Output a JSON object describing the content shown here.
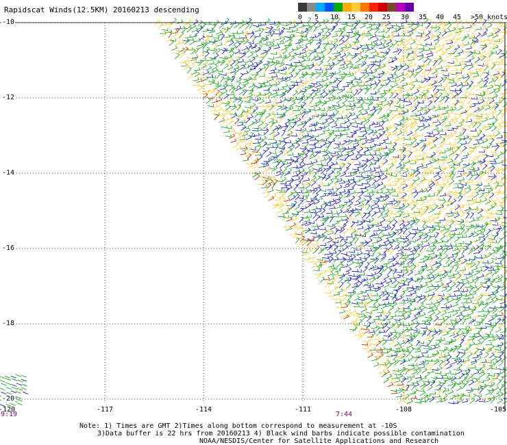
{
  "title": "Rapidscat Winds(12.5KM) 20160213 descending",
  "legend": {
    "labels": [
      "0",
      "5",
      "10",
      "15",
      "20",
      "25",
      "30",
      "35",
      "40",
      "45",
      ">50 knots"
    ],
    "colors": [
      "#3a3a3a",
      "#888888",
      "#00aaff",
      "#0055ff",
      "#00aa00",
      "#ffaa00",
      "#ffcc33",
      "#ff7700",
      "#ff2200",
      "#cc0000",
      "#7a4a2a",
      "#bb00bb",
      "#6600aa"
    ]
  },
  "axes": {
    "lat_labels": [
      "-10",
      "-12",
      "-14",
      "-16",
      "-18",
      "-20"
    ],
    "lon_labels": [
      "-120",
      "-117",
      "-114",
      "-111",
      "-108",
      "-105"
    ]
  },
  "time_labels": [
    "9:19",
    "7:44"
  ],
  "note": [
    "Note: 1) Times are GMT 2)Times along bottom correspond to measurement at -10S",
    "3)Data buffer is 22 hrs from 20160213 4) Black wind barbs indicate possible contamination",
    "NOAA/NESDIS/Center for Satellite Applications and Research"
  ],
  "barb_colors": {
    "green": "#22aa22",
    "yellow": "#ffcc33",
    "blue": "#2222cc",
    "red": "#cc3300"
  }
}
